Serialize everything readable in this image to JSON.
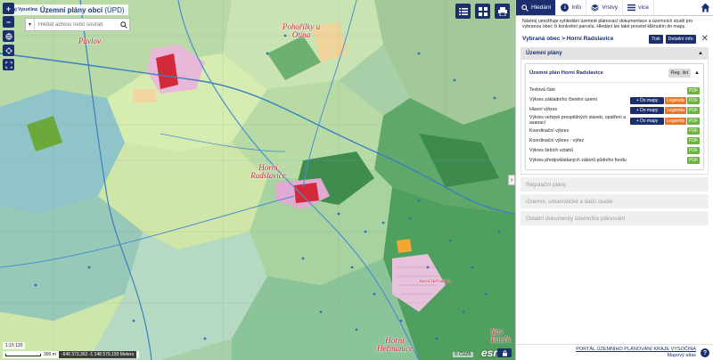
{
  "app": {
    "logo": "Kraj Vysočina",
    "title_main": "Územní plány obcí",
    "title_abbr": "(ÚPD)"
  },
  "search": {
    "dropdown_icon": "chevron-down-icon",
    "placeholder": "Hledat adresu nebo souřad",
    "button_icon": "search-icon"
  },
  "map": {
    "labels": [
      {
        "name": "Pavlov"
      },
      {
        "name": "Pohořílky u Otína"
      },
      {
        "name": "Horní Radslavice"
      },
      {
        "name": "Horní Heřmanice"
      },
      {
        "name": "Nov Telečk"
      },
      {
        "name": "Horní Heřmanice",
        "small": true
      }
    ],
    "scale": "1:15 120",
    "scale_length": "300 m",
    "coords": "-646 373,362 -1 148 579,193 Meters",
    "attribution": "© ČÚZK",
    "esri": "esri"
  },
  "panel": {
    "tabs": [
      {
        "label": "Hledání",
        "icon": "search-icon",
        "active": true
      },
      {
        "label": "Info",
        "icon": "info-icon",
        "active": false
      },
      {
        "label": "Vrstvy",
        "icon": "layers-icon",
        "active": false
      },
      {
        "label": "více",
        "icon": "menu-icon",
        "active": false
      }
    ],
    "home_icon": "home-icon",
    "intro": "Nástroj umožňuje vyhledání územně plánovací dokumentace a územních studií pro vybranou obec či konkrétní parcelu. Hledání lze také provést kliknutím do mapy.",
    "selected": {
      "title": "Vybraná obec > Horní Radslavice",
      "print": "Tisk",
      "detail": "Detailní info"
    },
    "uzemni_plany": {
      "header": "Územní plány",
      "plan_title": "Územní plán Horní Radslavice",
      "reg_list": "Reg. list",
      "docs": [
        {
          "label": "Textová část",
          "map": false,
          "legend": false
        },
        {
          "label": "Výkres základního členění území",
          "map": true,
          "legend": true
        },
        {
          "label": "Hlavní výkres",
          "map": true,
          "legend": true
        },
        {
          "label": "Výkres veřejně prospěšných staveb, opatření a asanací",
          "map": true,
          "legend": true
        },
        {
          "label": "Koordinační výkres",
          "map": false,
          "legend": false
        },
        {
          "label": "Koordinační výkres - výřez",
          "map": false,
          "legend": false
        },
        {
          "label": "Výkres širších vztahů",
          "map": false,
          "legend": false
        },
        {
          "label": "Výkres předpokládaných záborů půdního fondu",
          "map": false,
          "legend": false
        }
      ],
      "btn_map": "+ Do mapy",
      "btn_legend": "Legenda",
      "btn_pdf": "PDF"
    },
    "collapsed_sections": [
      "Regulační plány",
      "Územní, urbanistické a další studie",
      "Ostatní dokumenty územního plánování"
    ],
    "footer": {
      "portal": "PORTÁL ÚZEMNÍHO PLÁNOVÁNÍ KRAJE VYSOČINA",
      "atlas": "Mapový atlas",
      "help": "?"
    }
  },
  "colors": {
    "navy": "#1b2f6e",
    "legend_orange": "#e8772a",
    "pdf_green": "#6cb33f",
    "map_label_red": "#d0203a"
  }
}
